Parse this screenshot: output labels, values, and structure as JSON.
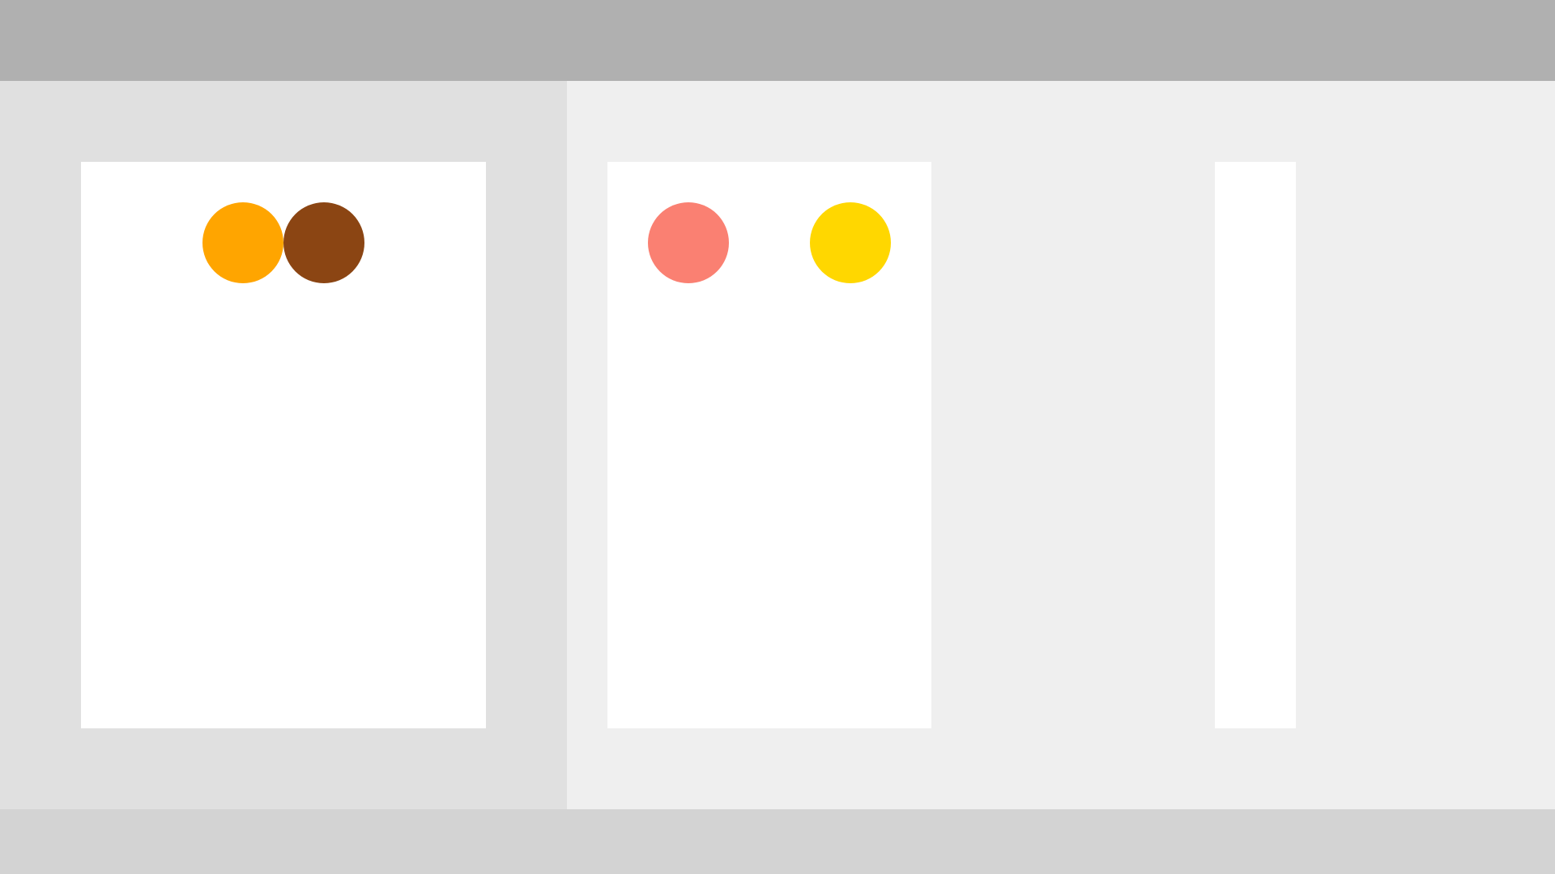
{
  "colors": {
    "top_bar": "#b0b0b0",
    "left_panel": "#e0e0e0",
    "right_panel": "#efefef",
    "bottom_bar": "#d3d3d3",
    "card": "#ffffff"
  },
  "cards": {
    "source": {
      "balls": [
        {
          "color_name": "orange",
          "color": "#ffa500"
        },
        {
          "color_name": "brown",
          "color": "#8b4513"
        }
      ]
    },
    "target_a": {
      "balls": [
        {
          "color_name": "salmon",
          "color": "#fa8072"
        },
        {
          "color_name": "gold",
          "color": "#ffd700"
        }
      ]
    },
    "target_b": {
      "balls": []
    }
  }
}
